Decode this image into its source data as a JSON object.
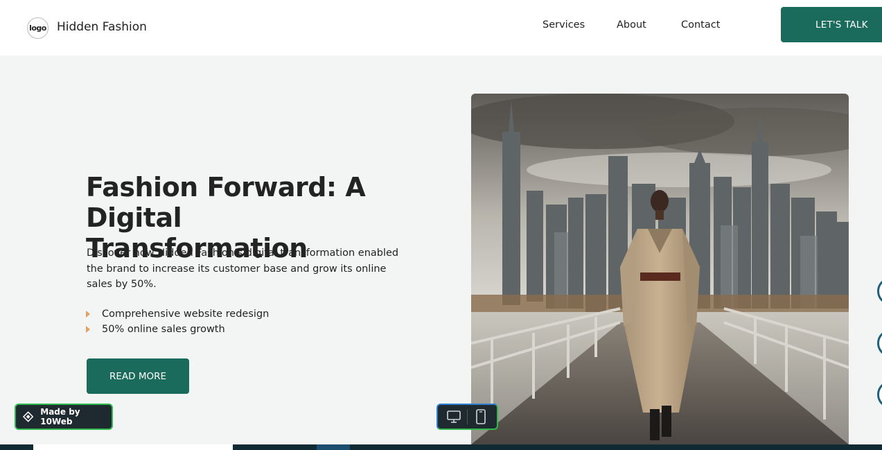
{
  "header": {
    "logo_text": "logo",
    "brand_name": "Hidden Fashion",
    "nav": [
      {
        "label": "Services"
      },
      {
        "label": "About"
      },
      {
        "label": "Contact"
      }
    ],
    "cta_label": "LET'S TALK"
  },
  "hero": {
    "title": "Fashion Forward: A Digital Transformation",
    "description": "Discover how Hidden Fashion’s digital transformation enabled the brand to increase its customer base and grow its online sales by 50%.",
    "bullets": [
      {
        "text": "Comprehensive website redesign"
      },
      {
        "text": "50% online sales growth"
      }
    ],
    "button_label": "READ MORE"
  },
  "badge": {
    "label": "Made by 10Web"
  },
  "colors": {
    "accent": "#1a6b5c",
    "hero_bg": "#f2f5f4",
    "bullet": "#e0a15f"
  }
}
